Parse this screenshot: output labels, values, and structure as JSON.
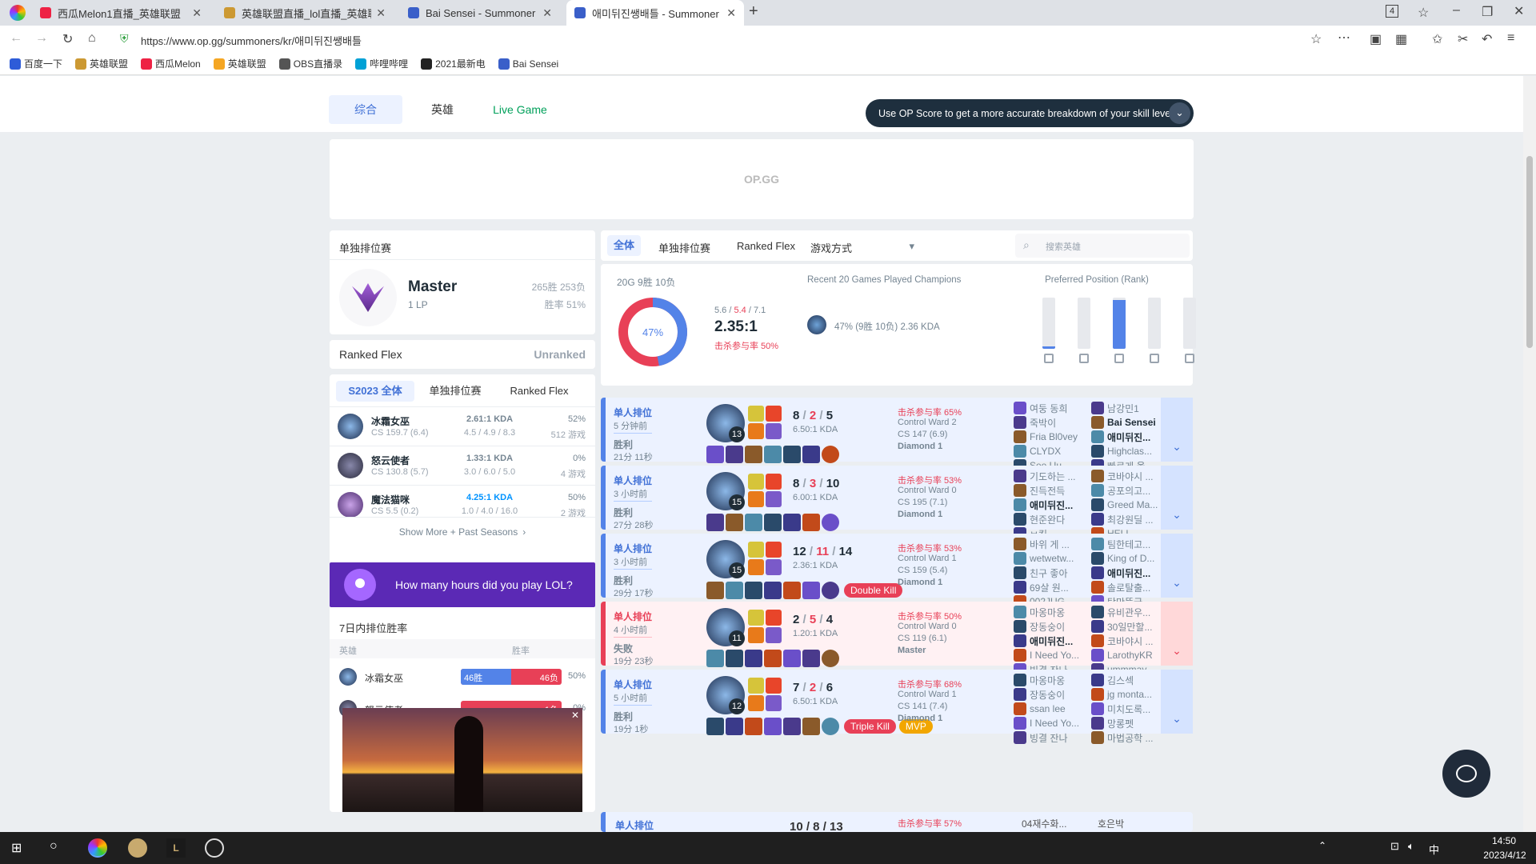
{
  "browser": {
    "tabs": [
      {
        "title": "西瓜Melon1直播_英雄联盟",
        "color": "#e24"
      },
      {
        "title": "英雄联盟直播_lol直播_英雄联",
        "color": "#c93"
      },
      {
        "title": "Bai Sensei - Summoner Stats",
        "color": "#3a5fc9"
      },
      {
        "title": "애미뒤진쌩배틀 - Summoner",
        "color": "#3a5fc9"
      }
    ],
    "new_tab": "+",
    "url": "https://www.op.gg/summoners/kr/애미뒤진쌩배틀",
    "bookmarks": [
      {
        "label": "百度一下",
        "color": "#2e5cd8"
      },
      {
        "label": "英雄联盟",
        "color": "#c93"
      },
      {
        "label": "西瓜Melon",
        "color": "#e24"
      },
      {
        "label": "英雄联盟",
        "color": "#f5a623"
      },
      {
        "label": "OBS直播录",
        "color": "#555"
      },
      {
        "label": "哔哩哔哩",
        "color": "#00a1d6"
      },
      {
        "label": "2021最新电",
        "color": "#222"
      },
      {
        "label": "Bai Sensei",
        "color": "#3a5fc9"
      }
    ],
    "window_badge": "4"
  },
  "nav": {
    "tabs": [
      "综合",
      "英雄",
      "Live Game"
    ],
    "notice": "Use OP Score to get a more accurate breakdown of your skill level.",
    "logo": "OP.GG"
  },
  "solo": {
    "title": "单独排位赛",
    "tier": "Master",
    "lp": "1 LP",
    "record": "265胜 253负",
    "winrate": "胜率 51%"
  },
  "flex": {
    "title": "Ranked Flex",
    "status": "Unranked"
  },
  "season": {
    "tabs": [
      "S2023 全体",
      "单独排位赛",
      "Ranked Flex"
    ],
    "champs": [
      {
        "name": "冰霜女巫",
        "cs": "CS 159.7 (6.4)",
        "kda": "2.61:1 KDA",
        "detail": "4.5 / 4.9 / 8.3",
        "wr": "52%",
        "games": "512 游戏"
      },
      {
        "name": "怒云使者",
        "cs": "CS 130.8 (5.7)",
        "kda": "1.33:1 KDA",
        "detail": "3.0 / 6.0 / 5.0",
        "wr": "0%",
        "games": "4 游戏"
      },
      {
        "name": "魔法猫咪",
        "cs": "CS 5.5 (0.2)",
        "kda": "4.25:1 KDA",
        "detail": "1.0 / 4.0 / 16.0",
        "wr": "50%",
        "games": "2 游戏"
      }
    ],
    "more": "Show More + Past Seasons"
  },
  "promo": "How many hours did you play LOL?",
  "week": {
    "title": "7日内排位胜率",
    "col1": "英雄",
    "col2": "胜率",
    "rows": [
      {
        "name": "冰霜女巫",
        "win": "46胜",
        "loss": "46负",
        "wr": "50%",
        "win_frac": 0.5
      },
      {
        "name": "怒云使者",
        "win": "",
        "loss": "1负",
        "wr": "0%",
        "win_frac": 0
      }
    ]
  },
  "filters": {
    "tabs": [
      "全体",
      "单独排位赛",
      "Ranked Flex"
    ],
    "mode": "游戏方式",
    "search_placeholder": "搜索英雄"
  },
  "summary": {
    "games": "20G 9胜 10负",
    "wr": "47%",
    "win_frac": 0.47,
    "kda_line": [
      "5.6",
      "5.4",
      "7.1"
    ],
    "kda": "2.35:1",
    "kp": "击杀参与率 50%",
    "recent_title": "Recent 20 Games Played Champions",
    "recent": "47% (9胜 10负) 2.36 KDA",
    "pos_title": "Preferred Position (Rank)",
    "positions": [
      {
        "name": "top-icon",
        "frac": 0.05
      },
      {
        "name": "jungle-icon",
        "frac": 0
      },
      {
        "name": "mid-icon",
        "frac": 0.95
      },
      {
        "name": "bot-icon",
        "frac": 0
      },
      {
        "name": "support-icon",
        "frac": 0
      }
    ]
  },
  "games": [
    {
      "result": "win",
      "queue": "单人排位",
      "ago": "5 分钟前",
      "outcome": "胜利",
      "dur": "21分 11秒",
      "lvl": "13",
      "k": "8",
      "d": "2",
      "a": "5",
      "ratio": "6.50:1 KDA",
      "kp": "击杀参与率 65%",
      "ward": "Control Ward 2",
      "cs": "CS 147 (6.9)",
      "rank": "Diamond 1",
      "badges": [],
      "team1": [
        "여둥 동희",
        "죽박이",
        "Fria Bl0vey",
        "CLYDX",
        "See Uu"
      ],
      "team2": [
        "남강민1",
        "Bai Sensei",
        "애미뒤진...",
        "Highclas...",
        "빠르게 올..."
      ]
    },
    {
      "result": "win",
      "queue": "单人排位",
      "ago": "3 小时前",
      "outcome": "胜利",
      "dur": "27分 28秒",
      "lvl": "15",
      "k": "8",
      "d": "3",
      "a": "10",
      "ratio": "6.00:1 KDA",
      "kp": "击杀参与率 53%",
      "ward": "Control Ward 0",
      "cs": "CS 195 (7.1)",
      "rank": "Diamond 1",
      "badges": [],
      "team1": [
        "기도하는 ...",
        "진득전득",
        "애미뒤진...",
        "현준완다",
        "ㅂ킥"
      ],
      "team2": [
        "코바야시 ...",
        "공포의고...",
        "Greed Ma...",
        "최강원딜 ...",
        "HELL"
      ]
    },
    {
      "result": "win",
      "queue": "单人排位",
      "ago": "3 小时前",
      "outcome": "胜利",
      "dur": "29分 17秒",
      "lvl": "15",
      "k": "12",
      "d": "11",
      "a": "14",
      "ratio": "2.36:1 KDA",
      "kp": "击杀参与率 53%",
      "ward": "Control Ward 1",
      "cs": "CS 159 (5.4)",
      "rank": "Diamond 1",
      "badges": [
        {
          "label": "Double Kill",
          "color": "#e84057"
        }
      ],
      "team1": [
        "바위 게 ...",
        "wetwetw...",
        "친구 좋아",
        "69살 원...",
        "002JUG"
      ],
      "team2": [
        "팀한테고...",
        "King of D...",
        "애미뒤진...",
        "솔로탈출...",
        "탁만뚯국"
      ]
    },
    {
      "result": "loss",
      "queue": "单人排位",
      "ago": "4 小时前",
      "outcome": "失败",
      "dur": "19分 23秒",
      "lvl": "11",
      "k": "2",
      "d": "5",
      "a": "4",
      "ratio": "1.20:1 KDA",
      "kp": "击杀参与率 50%",
      "ward": "Control Ward 0",
      "cs": "CS 119 (6.1)",
      "rank": "Master",
      "badges": [],
      "team1": [
        "마옹마옹",
        "장동숭이",
        "애미뒤진...",
        "I Need Yo...",
        "빙결 잔나"
      ],
      "team2": [
        "유비관우...",
        "30일만할...",
        "코바야시 ...",
        "LarothyKR",
        "ummmay..."
      ]
    },
    {
      "result": "win",
      "queue": "单人排位",
      "ago": "5 小时前",
      "outcome": "胜利",
      "dur": "19分 1秒",
      "lvl": "12",
      "k": "7",
      "d": "2",
      "a": "6",
      "ratio": "6.50:1 KDA",
      "kp": "击杀参与率 68%",
      "ward": "Control Ward 1",
      "cs": "CS 141 (7.4)",
      "rank": "Diamond 1",
      "badges": [
        {
          "label": "Triple Kill",
          "color": "#e84057"
        },
        {
          "label": "MVP",
          "color": "#f2a600"
        }
      ],
      "team1": [
        "마옹마옹",
        "장동숭이",
        "ssan lee",
        "I Need Yo...",
        "빙결 잔나"
      ],
      "team2": [
        "김스섹",
        "jg monta...",
        "미치도록...",
        "망롱펫",
        "마법공학 ..."
      ]
    }
  ],
  "partial_game": {
    "queue": "单人排位",
    "kda": "10 / 8 / 13",
    "kp": "击杀参与率 57%",
    "t1": "04재수화...",
    "t2": "호은박"
  },
  "taskbar": {
    "time": "14:50",
    "date": "2023/4/12",
    "ime": "中"
  }
}
